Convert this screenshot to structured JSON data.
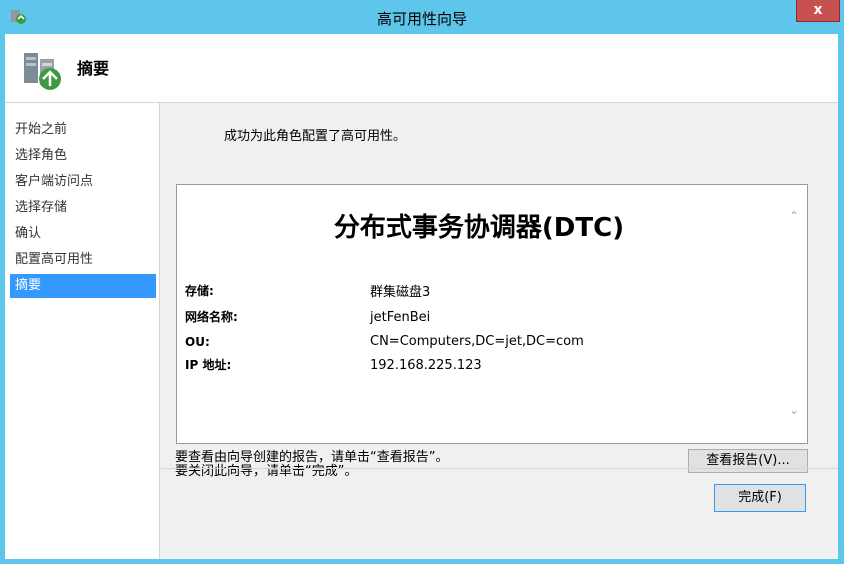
{
  "window": {
    "title": "高可用性向导",
    "close_label": "x",
    "accent_color": "#5ec6ea"
  },
  "header": {
    "title": "摘要",
    "icon": "server-wizard-icon"
  },
  "nav": {
    "items": [
      {
        "label": "开始之前",
        "active": false
      },
      {
        "label": "选择角色",
        "active": false
      },
      {
        "label": "客户端访问点",
        "active": false
      },
      {
        "label": "选择存储",
        "active": false
      },
      {
        "label": "确认",
        "active": false
      },
      {
        "label": "配置高可用性",
        "active": false
      },
      {
        "label": "摘要",
        "active": true
      }
    ]
  },
  "main": {
    "success_message": "成功为此角色配置了高可用性。",
    "report": {
      "title": "分布式事务协调器(DTC)",
      "rows": [
        {
          "label": "存储:",
          "value": "群集磁盘3"
        },
        {
          "label": "网络名称:",
          "value": "jetFenBei"
        },
        {
          "label": "OU:",
          "value": "CN=Computers,DC=jet,DC=com"
        },
        {
          "label": "IP 地址:",
          "value": "192.168.225.123"
        }
      ]
    },
    "instructions": [
      "要查看由向导创建的报告，请单击“查看报告”。",
      "要关闭此向导，请单击“完成”。"
    ],
    "view_report_label": "查看报告(V)...",
    "finish_label": "完成(F)"
  }
}
